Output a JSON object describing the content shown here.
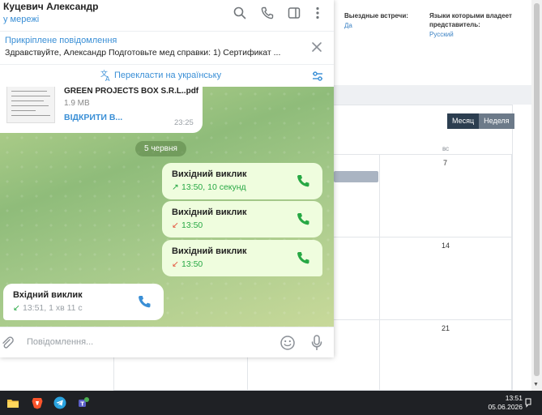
{
  "crm": {
    "fields": [
      {
        "label": "Выездные встречи:",
        "value": "Да"
      },
      {
        "label": "Языки которыми владеет представитель:",
        "value": "Русский"
      }
    ],
    "view_toggle": {
      "month": "Месяц",
      "week": "Неделя"
    },
    "calendar": {
      "day_header": "вс",
      "dates": [
        "7",
        "14",
        "21"
      ]
    }
  },
  "telegram": {
    "header": {
      "name": "Куцевич Александр",
      "status": "у мережі"
    },
    "pinned": {
      "title": "Прикріплене повідомлення",
      "text": "Здравствуйте, Александр Подготовьте мед справки: 1) Сертификат ..."
    },
    "translate": {
      "label": "Перекласти на українську"
    },
    "file_message": {
      "name": "GREEN PROJECTS BOX S.R.L..pdf",
      "size": "1.9 MB",
      "open_label": "ВІДКРИТИ В...",
      "time": "23:25"
    },
    "date_separator": "5 червня",
    "calls": [
      {
        "direction": "outgoing",
        "title": "Вихідний виклик",
        "arrow": "↗",
        "arrow_color": "#27a844",
        "info": "13:50, 10 секунд"
      },
      {
        "direction": "outgoing",
        "title": "Вихідний виклик",
        "arrow": "↙",
        "arrow_color": "#e5533c",
        "info": "13:50"
      },
      {
        "direction": "outgoing",
        "title": "Вихідний виклик",
        "arrow": "↙",
        "arrow_color": "#e5533c",
        "info": "13:50"
      },
      {
        "direction": "incoming",
        "title": "Вхідний виклик",
        "arrow": "↙",
        "arrow_color": "#27a844",
        "info": "13:51, 1 хв 11 с"
      }
    ],
    "composer": {
      "placeholder": "Повідомлення..."
    }
  },
  "taskbar": {
    "time": "13:51",
    "date": "05.06.2026",
    "apps": [
      "file-explorer-icon",
      "brave-browser-icon",
      "telegram-icon",
      "teams-icon"
    ]
  },
  "colors": {
    "accent": "#3a8fd6",
    "call_green": "#27a844",
    "call_red": "#e5533c",
    "outgoing_bubble": "#effdde"
  }
}
